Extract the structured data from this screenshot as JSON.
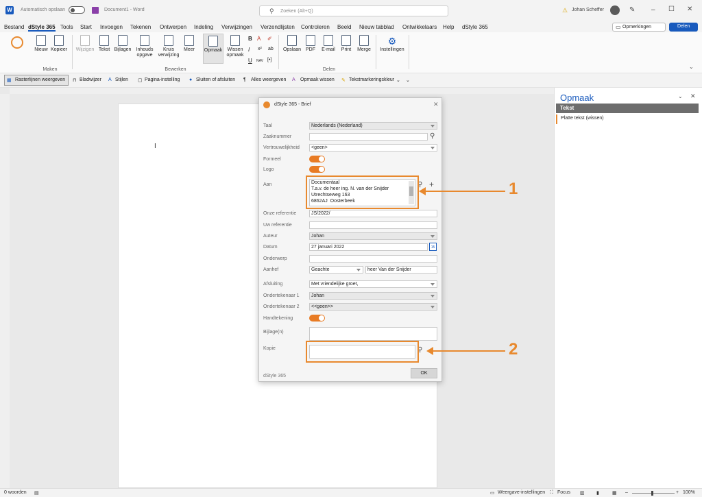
{
  "titlebar": {
    "autosave_label": "Automatisch opslaan",
    "doc_title": "Document1 - Word",
    "search_placeholder": "Zoeken (Alt+Q)",
    "user": "Johan Scheffer"
  },
  "menu": [
    "Bestand",
    "dStyle 365",
    "Tools",
    "Start",
    "Invoegen",
    "Tekenen",
    "Ontwerpen",
    "Indeling",
    "Verwijzingen",
    "Verzendlijsten",
    "Controleren",
    "Beeld",
    "Nieuw tabblad",
    "Ontwikkelaars",
    "Help",
    "dStyle 365"
  ],
  "menu_right": {
    "comments": "Opmerkingen",
    "share": "Delen"
  },
  "ribbon": {
    "nieuw": "Nieuw",
    "kopieer": "Kopieer",
    "wijzigen": "Wijzigen",
    "tekst": "Tekst",
    "bijlagen": "Bijlagen",
    "inhoud1": "Inhouds",
    "inhoud2": "opgave",
    "kruis1": "Kruis",
    "kruis2": "verwijzing",
    "meer": "Meer",
    "opmaak": "Opmaak",
    "wissen1": "Wissen",
    "wissen2": "opmaak",
    "opslaan": "Opslaan",
    "pdf": "PDF",
    "email": "E-mail",
    "print": "Print",
    "merge": "Merge",
    "instellingen": "Instellingen",
    "group_maken": "Maken",
    "group_bewerken": "Bewerken",
    "group_delen": "Delen",
    "fmt_bold": "B",
    "fmt_italic": "I",
    "fmt_under": "U",
    "fmt_nav": "NAV",
    "fmt_bracket": "[•]"
  },
  "quickbar": [
    "Rasterlijnen weergeven",
    "Bladwijzer",
    "Stijlen",
    "Pagina-instelling",
    "Sluiten of afsluiten",
    "Alles weergeven",
    "Opmaak wissen",
    "Tekstmarkeringskleur"
  ],
  "dialog": {
    "title": "dStyle 365 - Brief",
    "taal_label": "Taal",
    "taal_value": "Nederlands (Nederland)",
    "zaak_label": "Zaaknummer",
    "vertr_label": "Vertrouwelijkheid",
    "vertr_value": "<geen>",
    "formeel_label": "Formeel",
    "logo_label": "Logo",
    "aan_label": "Aan",
    "aan_lines": [
      "Documentaal",
      "T.a.v. de heer ing. N. van der Snijder",
      "Utrechtseweg 163",
      "6862AJ  Oosterbeek"
    ],
    "onze_label": "Onze referentie",
    "onze_value": "JS/2022/",
    "uw_label": "Uw referentie",
    "auteur_label": "Auteur",
    "auteur_value": "Johan",
    "datum_label": "Datum",
    "datum_value": "27 januari 2022",
    "cal_day": "15",
    "onderwerp_label": "Onderwerp",
    "aanhef_label": "Aanhef",
    "aanhef_value": "Geachte",
    "aanhef_name": "heer Van der Snijder",
    "afsl_label": "Afsluiting",
    "afsl_value": "Met vriendelijke groet,",
    "ond1_label": "Ondertekenaar 1",
    "ond1_value": "Johan",
    "ond2_label": "Ondertekenaar 2",
    "ond2_value": "<<geen>>",
    "hand_label": "Handtekening",
    "bijl_label": "Bijlage(n)",
    "kopie_label": "Kopie",
    "footer": "dStyle 365",
    "ok": "OK"
  },
  "panel": {
    "title": "Opmaak",
    "section": "Tekst",
    "item": "Platte tekst (wissen)"
  },
  "status": {
    "words": "0 woorden",
    "view": "Weergave-instellingen",
    "focus": "Focus",
    "zoom": "100%"
  },
  "callouts": [
    "1",
    "2"
  ],
  "colors": {
    "accent": "#e8892e",
    "toggle": "#e87b24",
    "word_blue": "#185abd",
    "panel_header": "#6d6d6d"
  }
}
